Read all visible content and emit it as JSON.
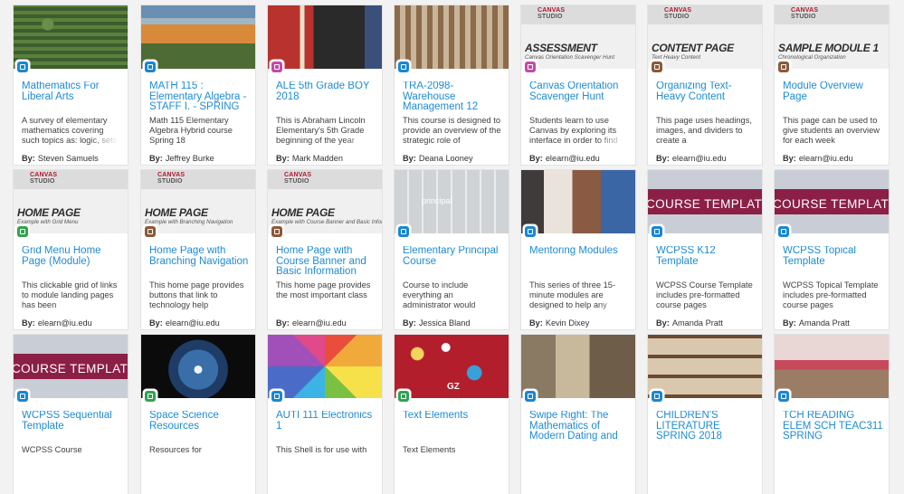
{
  "cards": [
    {
      "title": "Mathematics For Liberal Arts",
      "desc": "A survey of elementary mathematics covering such topics as: logic, sets",
      "author_label": "By:",
      "author": "Steven Samuels",
      "badge": "course"
    },
    {
      "title": "MATH 115 : Elementary Algebra - STAFF I. - SPRING",
      "desc": "Math 115 Elementary Algebra Hybrid course Spring 18",
      "author_label": "By:",
      "author": "Jeffrey Burke",
      "badge": "course"
    },
    {
      "title": "ALE 5th Grade BOY 2018",
      "desc": "This is Abraham Lincoln Elementary's 5th Grade beginning of the year",
      "author_label": "By:",
      "author": "Mark Madden",
      "badge": "module"
    },
    {
      "title": "TRA-2098-Warehouse Management 12",
      "desc": "This course is designed to provide an overview of the strategic role of",
      "author_label": "By:",
      "author": "Deana Looney",
      "badge": "course"
    },
    {
      "title": "Canvas Orientation Scavenger Hunt",
      "desc": "Students learn to use Canvas by exploring its interface in order to find",
      "author_label": "By:",
      "author": "elearn@iu.edu",
      "badge": "module",
      "thumb_big": "ASSESSMENT",
      "thumb_sub": "Canvas Orientation Scavenger Hunt"
    },
    {
      "title": "Organizing Text-Heavy Content",
      "desc": "This page uses headings, images, and dividers to create a",
      "author_label": "By:",
      "author": "elearn@iu.edu",
      "badge": "page",
      "thumb_big": "CONTENT PAGE",
      "thumb_sub": "Text Heavy Content"
    },
    {
      "title": "Module Overview Page",
      "desc": "This page can be used to give students an overview for each week",
      "author_label": "By:",
      "author": "elearn@iu.edu",
      "badge": "page",
      "thumb_big": "SAMPLE MODULE 1",
      "thumb_sub": "Chronological Organization"
    },
    {
      "title": "Grid Menu Home Page (Module)",
      "desc": "This clickable grid of links to module landing pages has been",
      "author_label": "By:",
      "author": "elearn@iu.edu",
      "badge": "quiz",
      "thumb_big": "HOME PAGE",
      "thumb_sub": "Example with Grid Menu"
    },
    {
      "title": "Home Page with Branching Navigation",
      "desc": "This home page provides buttons that link to technology help",
      "author_label": "By:",
      "author": "elearn@iu.edu",
      "badge": "page",
      "thumb_big": "HOME PAGE",
      "thumb_sub": "Example with Branching Navigation"
    },
    {
      "title": "Home Page with Course Banner and Basic Information",
      "desc": "This home page provides the most important class",
      "author_label": "By:",
      "author": "elearn@iu.edu",
      "badge": "page",
      "thumb_big": "HOME PAGE",
      "thumb_sub": "Example with Course Banner and Basic Information"
    },
    {
      "title": "Elementary Principal Course",
      "desc": "Course to include everything an administrator would",
      "author_label": "By:",
      "author": "Jessica Bland",
      "badge": "course",
      "thumb_key": "principal"
    },
    {
      "title": "Mentoring Modules",
      "desc": "This series of three 15-minute modules are designed to help any",
      "author_label": "By:",
      "author": "Kevin Dixey",
      "badge": "course"
    },
    {
      "title": "WCPSS K12 Template",
      "desc": "WCPSS Course Template includes pre-formatted course pages",
      "author_label": "By:",
      "author": "Amanda Pratt",
      "badge": "course",
      "thumb_tmpl": "COURSE TEMPLATE"
    },
    {
      "title": "WCPSS Topical Template",
      "desc": "WCPSS Topical Template includes pre-formatted course pages",
      "author_label": "By:",
      "author": "Amanda Pratt",
      "badge": "course",
      "thumb_tmpl": "COURSE TEMPLATE"
    },
    {
      "title": "WCPSS Sequential Template",
      "desc": "WCPSS Course",
      "author_label": "",
      "author": "",
      "badge": "course",
      "thumb_tmpl": "COURSE TEMPLATE"
    },
    {
      "title": "Space Science Resources",
      "desc": "Resources for",
      "author_label": "",
      "author": "",
      "badge": "quiz"
    },
    {
      "title": "AUTI 111 Electronics 1",
      "desc": "This Shell is for use with",
      "author_label": "",
      "author": "",
      "badge": "course"
    },
    {
      "title": "Text Elements",
      "desc": "Text Elements",
      "author_label": "",
      "author": "",
      "badge": "quiz",
      "thumb_gz": "GZ"
    },
    {
      "title": "Swipe Right: The Mathematics of Modern Dating and",
      "desc": "",
      "author_label": "",
      "author": "",
      "badge": "course"
    },
    {
      "title": "CHILDREN'S LITERATURE SPRING 2018",
      "desc": "",
      "author_label": "",
      "author": "",
      "badge": "course"
    },
    {
      "title": "TCH READING ELEM SCH TEAC311 SPRING",
      "desc": "",
      "author_label": "",
      "author": "",
      "badge": "course"
    }
  ],
  "studio_label_1": "CANVAS",
  "studio_label_2": "STUDIO"
}
